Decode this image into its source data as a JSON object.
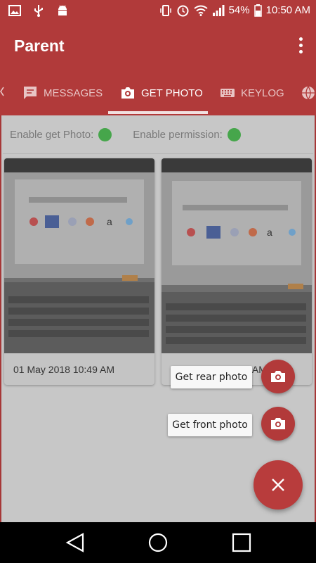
{
  "status_bar": {
    "battery": "54%",
    "time": "10:50 AM"
  },
  "app": {
    "title": "Parent"
  },
  "tabs": [
    {
      "label": "MESSAGES",
      "icon": "message-icon"
    },
    {
      "label": "GET PHOTO",
      "icon": "camera-icon"
    },
    {
      "label": "KEYLOG",
      "icon": "keyboard-icon"
    },
    {
      "label": "",
      "icon": "globe-icon"
    }
  ],
  "status": {
    "get_photo_label": "Enable get Photo:",
    "permission_label": "Enable permission:"
  },
  "photos": [
    {
      "date": "01 May 2018 10:49 AM"
    },
    {
      "date": "9 AM"
    }
  ],
  "fab_menu": {
    "rear_label": "Get rear photo",
    "front_label": "Get front photo"
  },
  "colors": {
    "primary": "#b13a3a",
    "accent": "#b83c3c",
    "status_ok": "#46a64b"
  }
}
